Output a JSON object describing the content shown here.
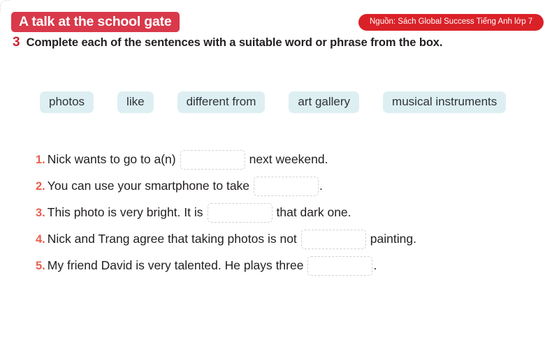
{
  "header": {
    "title_badge": "A talk at the school gate",
    "source_pill": "Nguồn: Sách Global Success Tiếng Anh lớp 7",
    "exercise_number": "3",
    "instruction": "Complete each of the sentences with a suitable word or phrase from the box."
  },
  "word_bank": {
    "chips": [
      {
        "label": "photos"
      },
      {
        "label": "like"
      },
      {
        "label": "different from"
      },
      {
        "label": "art gallery"
      },
      {
        "label": "musical instruments"
      }
    ]
  },
  "sentences": [
    {
      "number": "1.",
      "before": "Nick wants to go to a(n)",
      "blank_value": "",
      "after": "next weekend."
    },
    {
      "number": "2.",
      "before": "You can use your smartphone to take",
      "blank_value": "",
      "after": "."
    },
    {
      "number": "3.",
      "before": "This photo is very bright. It is",
      "blank_value": "",
      "after": "that dark one."
    },
    {
      "number": "4.",
      "before": "Nick and Trang agree that taking photos is not",
      "blank_value": "",
      "after": "painting."
    },
    {
      "number": "5.",
      "before": "My friend David is very talented. He plays three",
      "blank_value": "",
      "after": "."
    }
  ],
  "colors": {
    "badge_red": "#d9394b",
    "pill_red": "#da2128",
    "number_red": "#cf2233",
    "list_number_red": "#e8604f",
    "chip_blue": "#ddeff3",
    "text_dark": "#231f20",
    "blank_border": "#d2d2d2"
  }
}
